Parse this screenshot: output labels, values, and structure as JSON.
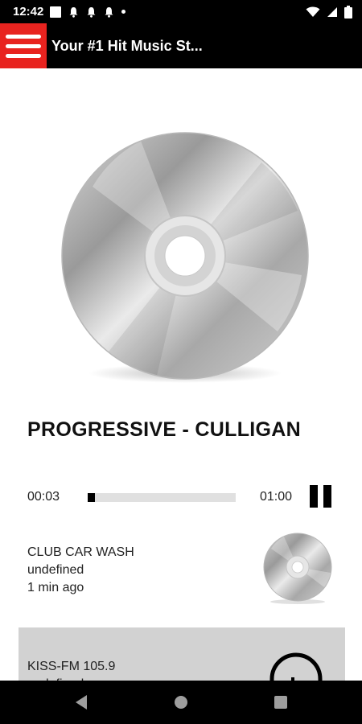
{
  "status_bar": {
    "time": "12:42",
    "icons": [
      "square-notification-icon",
      "bell-icon",
      "bell-icon",
      "bell-icon",
      "dot-icon",
      "wifi-icon",
      "signal-icon",
      "battery-icon"
    ]
  },
  "header": {
    "title": "Your #1 Hit Music St...",
    "menu_icon": "hamburger-menu-icon",
    "accent_color": "#e8231f"
  },
  "now_playing": {
    "title": "PROGRESSIVE - CULLIGAN",
    "elapsed": "00:03",
    "duration": "01:00",
    "progress": 0.05,
    "control_icon": "pause-icon"
  },
  "history": [
    {
      "line1": "CLUB CAR WASH",
      "line2": "undefined",
      "line3": "1 min ago",
      "art_icon": "cd-icon"
    },
    {
      "line1": "KISS-FM 105.9",
      "line2": "undefined",
      "art_icon": "headphones-icon",
      "background": "#d2d2d2"
    }
  ],
  "nav_bar": {
    "icons": [
      "back-icon",
      "home-icon",
      "recents-icon"
    ]
  }
}
